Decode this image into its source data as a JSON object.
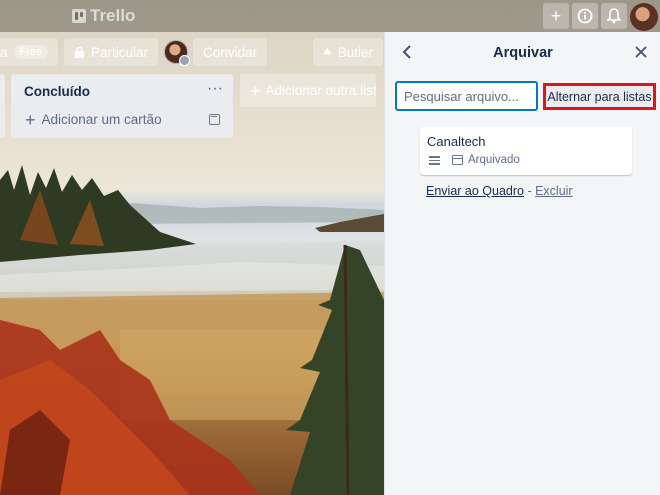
{
  "header": {
    "logo_text": "Trello",
    "icons": [
      "plus-icon",
      "info-icon",
      "bell-icon"
    ]
  },
  "board_header": {
    "board_name_tail": "a",
    "free_badge": "Free",
    "visibility_label": "Particular",
    "invite_label": "Convidar",
    "butler_label": "Butler"
  },
  "list": {
    "title": "Concluído",
    "menu_label": "···",
    "add_card_label": "Adicionar um cartão"
  },
  "add_list_label": "Adicionar outra lista",
  "archive_panel": {
    "title": "Arquivar",
    "search_placeholder": "Pesquisar arquivo...",
    "search_value": "",
    "toggle_button": "Alternar para listas",
    "cards": [
      {
        "title": "Canaltech",
        "badge": "Arquivado",
        "send_link": "Enviar ao Quadro",
        "separator": " - ",
        "delete_link": "Excluir"
      }
    ]
  },
  "colors": {
    "highlight_border": "#e0141e",
    "search_border": "#0079bf",
    "panel_bg": "#f4f5f7",
    "list_bg": "#ebecf0"
  }
}
